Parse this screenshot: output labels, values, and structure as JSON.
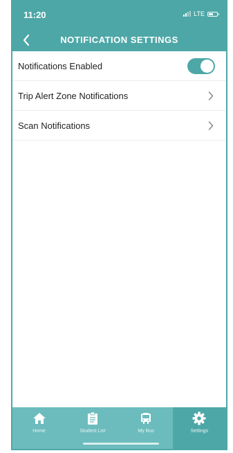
{
  "status_bar": {
    "time": "11:20",
    "network": "LTE"
  },
  "header": {
    "title": "NOTIFICATION SETTINGS",
    "back_icon": "chevron-left-icon"
  },
  "settings": [
    {
      "label": "Notifications Enabled",
      "control": "toggle",
      "enabled": true
    },
    {
      "label": "Trip Alert Zone Notifications",
      "control": "chevron"
    },
    {
      "label": "Scan Notifications",
      "control": "chevron"
    }
  ],
  "tabs": [
    {
      "label": "Home",
      "icon": "home-icon",
      "active": false
    },
    {
      "label": "Student List",
      "icon": "clipboard-icon",
      "active": false
    },
    {
      "label": "My Bus",
      "icon": "bus-icon",
      "active": false
    },
    {
      "label": "Settings",
      "icon": "gear-icon",
      "active": true
    }
  ],
  "colors": {
    "primary": "#4ea7a7",
    "tab_bar": "#6cbcbd",
    "background": "#ffffff",
    "text": "#222222"
  }
}
